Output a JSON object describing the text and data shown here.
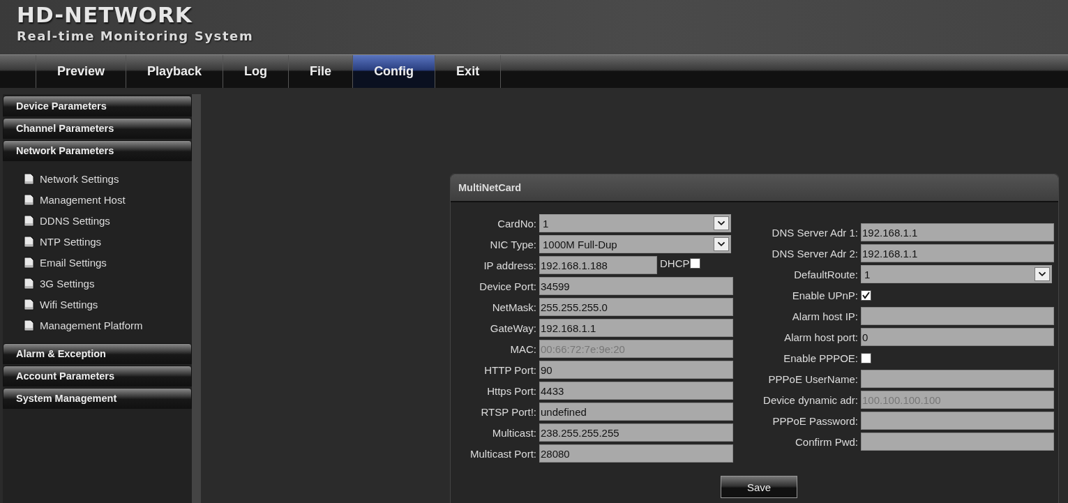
{
  "header": {
    "title": "HD-NETWORK",
    "subtitle": "Real-time Monitoring System"
  },
  "nav": [
    {
      "label": "Preview",
      "selected": false
    },
    {
      "label": "Playback",
      "selected": false
    },
    {
      "label": "Log",
      "selected": false
    },
    {
      "label": "File",
      "selected": false
    },
    {
      "label": "Config",
      "selected": true
    },
    {
      "label": "Exit",
      "selected": false
    }
  ],
  "sidebar": [
    {
      "label": "Device Parameters"
    },
    {
      "label": "Channel Parameters"
    },
    {
      "label": "Network Parameters",
      "items": [
        "Network Settings",
        "Management Host",
        "DDNS Settings",
        "NTP Settings",
        "Email Settings",
        "3G Settings",
        "Wifi Settings",
        "Management Platform"
      ]
    },
    {
      "label": "Alarm & Exception"
    },
    {
      "label": "Account Parameters"
    },
    {
      "label": "System Management"
    }
  ],
  "panel": {
    "title": "MultiNetCard",
    "left_fields": [
      {
        "kind": "select",
        "label": "CardNo:",
        "value": "1"
      },
      {
        "kind": "select",
        "label": "NIC Type:",
        "value": "1000M Full-Dup"
      },
      {
        "kind": "text_check",
        "label": "IP address:",
        "value": "192.168.1.188",
        "check_label": "DHCP",
        "checked": false
      },
      {
        "kind": "text",
        "label": "Device Port:",
        "value": "34599"
      },
      {
        "kind": "text",
        "label": "NetMask:",
        "value": "255.255.255.0"
      },
      {
        "kind": "text",
        "label": "GateWay:",
        "value": "192.168.1.1"
      },
      {
        "kind": "text",
        "label": "MAC:",
        "value": "00:66:72:7e:9e:20",
        "disabled": true
      },
      {
        "kind": "text",
        "label": "HTTP Port:",
        "value": "90"
      },
      {
        "kind": "text",
        "label": "Https Port:",
        "value": "4433"
      },
      {
        "kind": "text",
        "label": "RTSP Port!:",
        "value": "undefined"
      },
      {
        "kind": "text",
        "label": "Multicast:",
        "value": "238.255.255.255"
      },
      {
        "kind": "text",
        "label": "Multicast Port:",
        "value": "28080"
      }
    ],
    "right_fields": [
      {
        "kind": "text",
        "label": "DNS Server Adr 1:",
        "value": "192.168.1.1"
      },
      {
        "kind": "text",
        "label": "DNS Server Adr 2:",
        "value": "192.168.1.1"
      },
      {
        "kind": "select",
        "label": "DefaultRoute:",
        "value": "1"
      },
      {
        "kind": "checkbox",
        "label": "Enable UPnP:",
        "checked": true
      },
      {
        "kind": "text",
        "label": "Alarm host IP:"
      },
      {
        "kind": "text",
        "label": "Alarm host port:",
        "value": "0"
      },
      {
        "kind": "checkbox",
        "label": "Enable PPPOE:",
        "checked": false
      },
      {
        "kind": "text",
        "label": "PPPoE UserName:"
      },
      {
        "kind": "text",
        "label": "Device dynamic adr:",
        "value": "100.100.100.100",
        "disabled": true
      },
      {
        "kind": "text",
        "label": "PPPoE Password:"
      },
      {
        "kind": "text",
        "label": "Confirm Pwd:"
      }
    ],
    "save_button": "Save"
  }
}
